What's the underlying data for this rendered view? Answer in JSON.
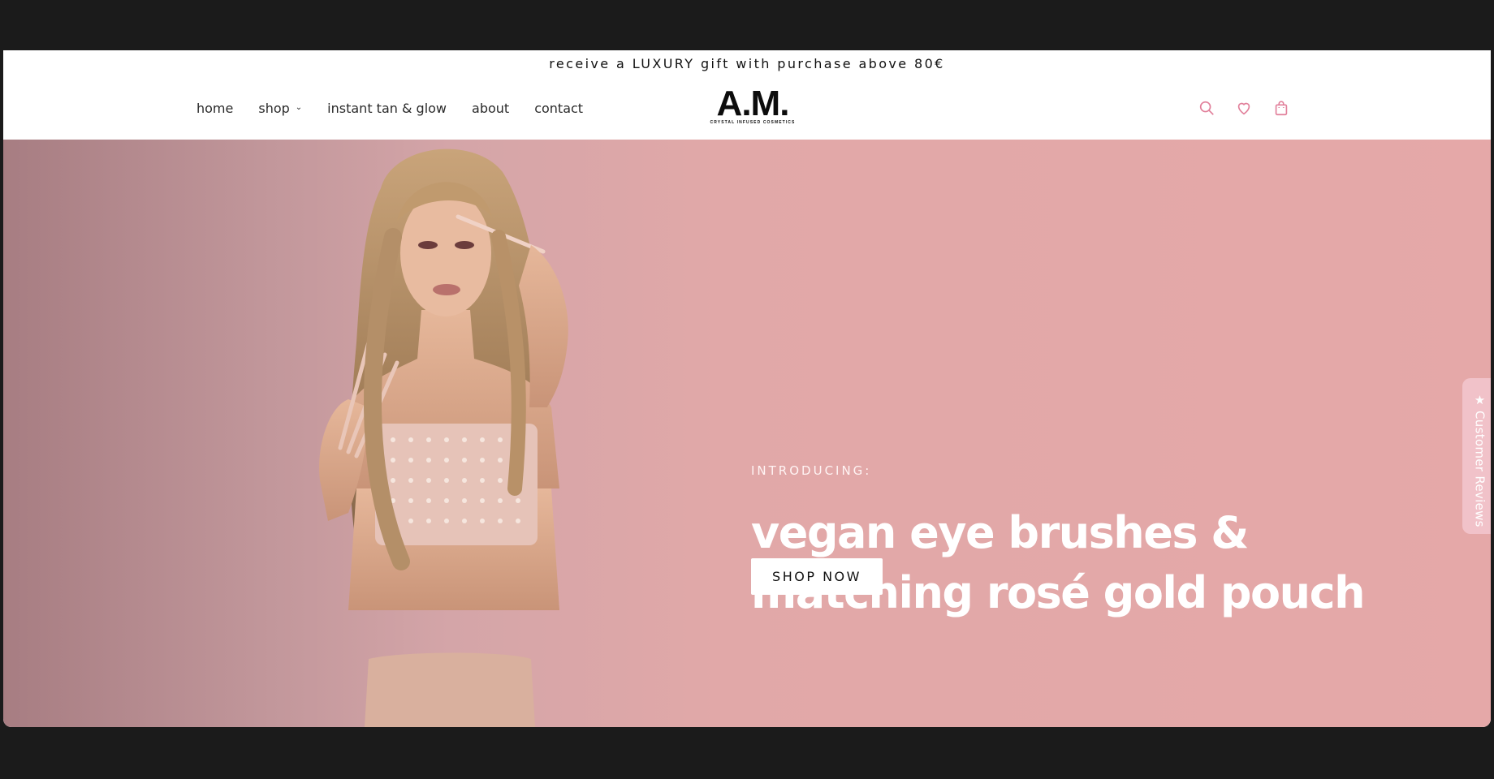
{
  "announcement": "receive a LUXURY gift with purchase above 80€",
  "nav": {
    "items": [
      {
        "label": "home"
      },
      {
        "label": "shop",
        "chevron": "⌄"
      },
      {
        "label": "instant tan & glow"
      },
      {
        "label": "about"
      },
      {
        "label": "contact"
      }
    ]
  },
  "logo": {
    "main": "A.M.",
    "tagline": "CRYSTAL INFUSED COSMETICS"
  },
  "header_icons": [
    "search-icon",
    "heart-icon",
    "shopping-bag-icon"
  ],
  "hero": {
    "intro": "INTRODUCING:",
    "headline_line1": "vegan eye brushes &",
    "headline_line2": "matching rosé gold pouch",
    "cta": "SHOP NOW",
    "slides_total": 4,
    "active_slide": 3
  },
  "reviews_tab": {
    "label": "Customer Reviews",
    "icon": "star-icon"
  },
  "widget": {
    "badge": "!",
    "icon": "clipboard-icon"
  },
  "colors": {
    "accent": "#e17f9a",
    "hero_bg": "#e5a8a8",
    "text_dark": "#111111"
  }
}
